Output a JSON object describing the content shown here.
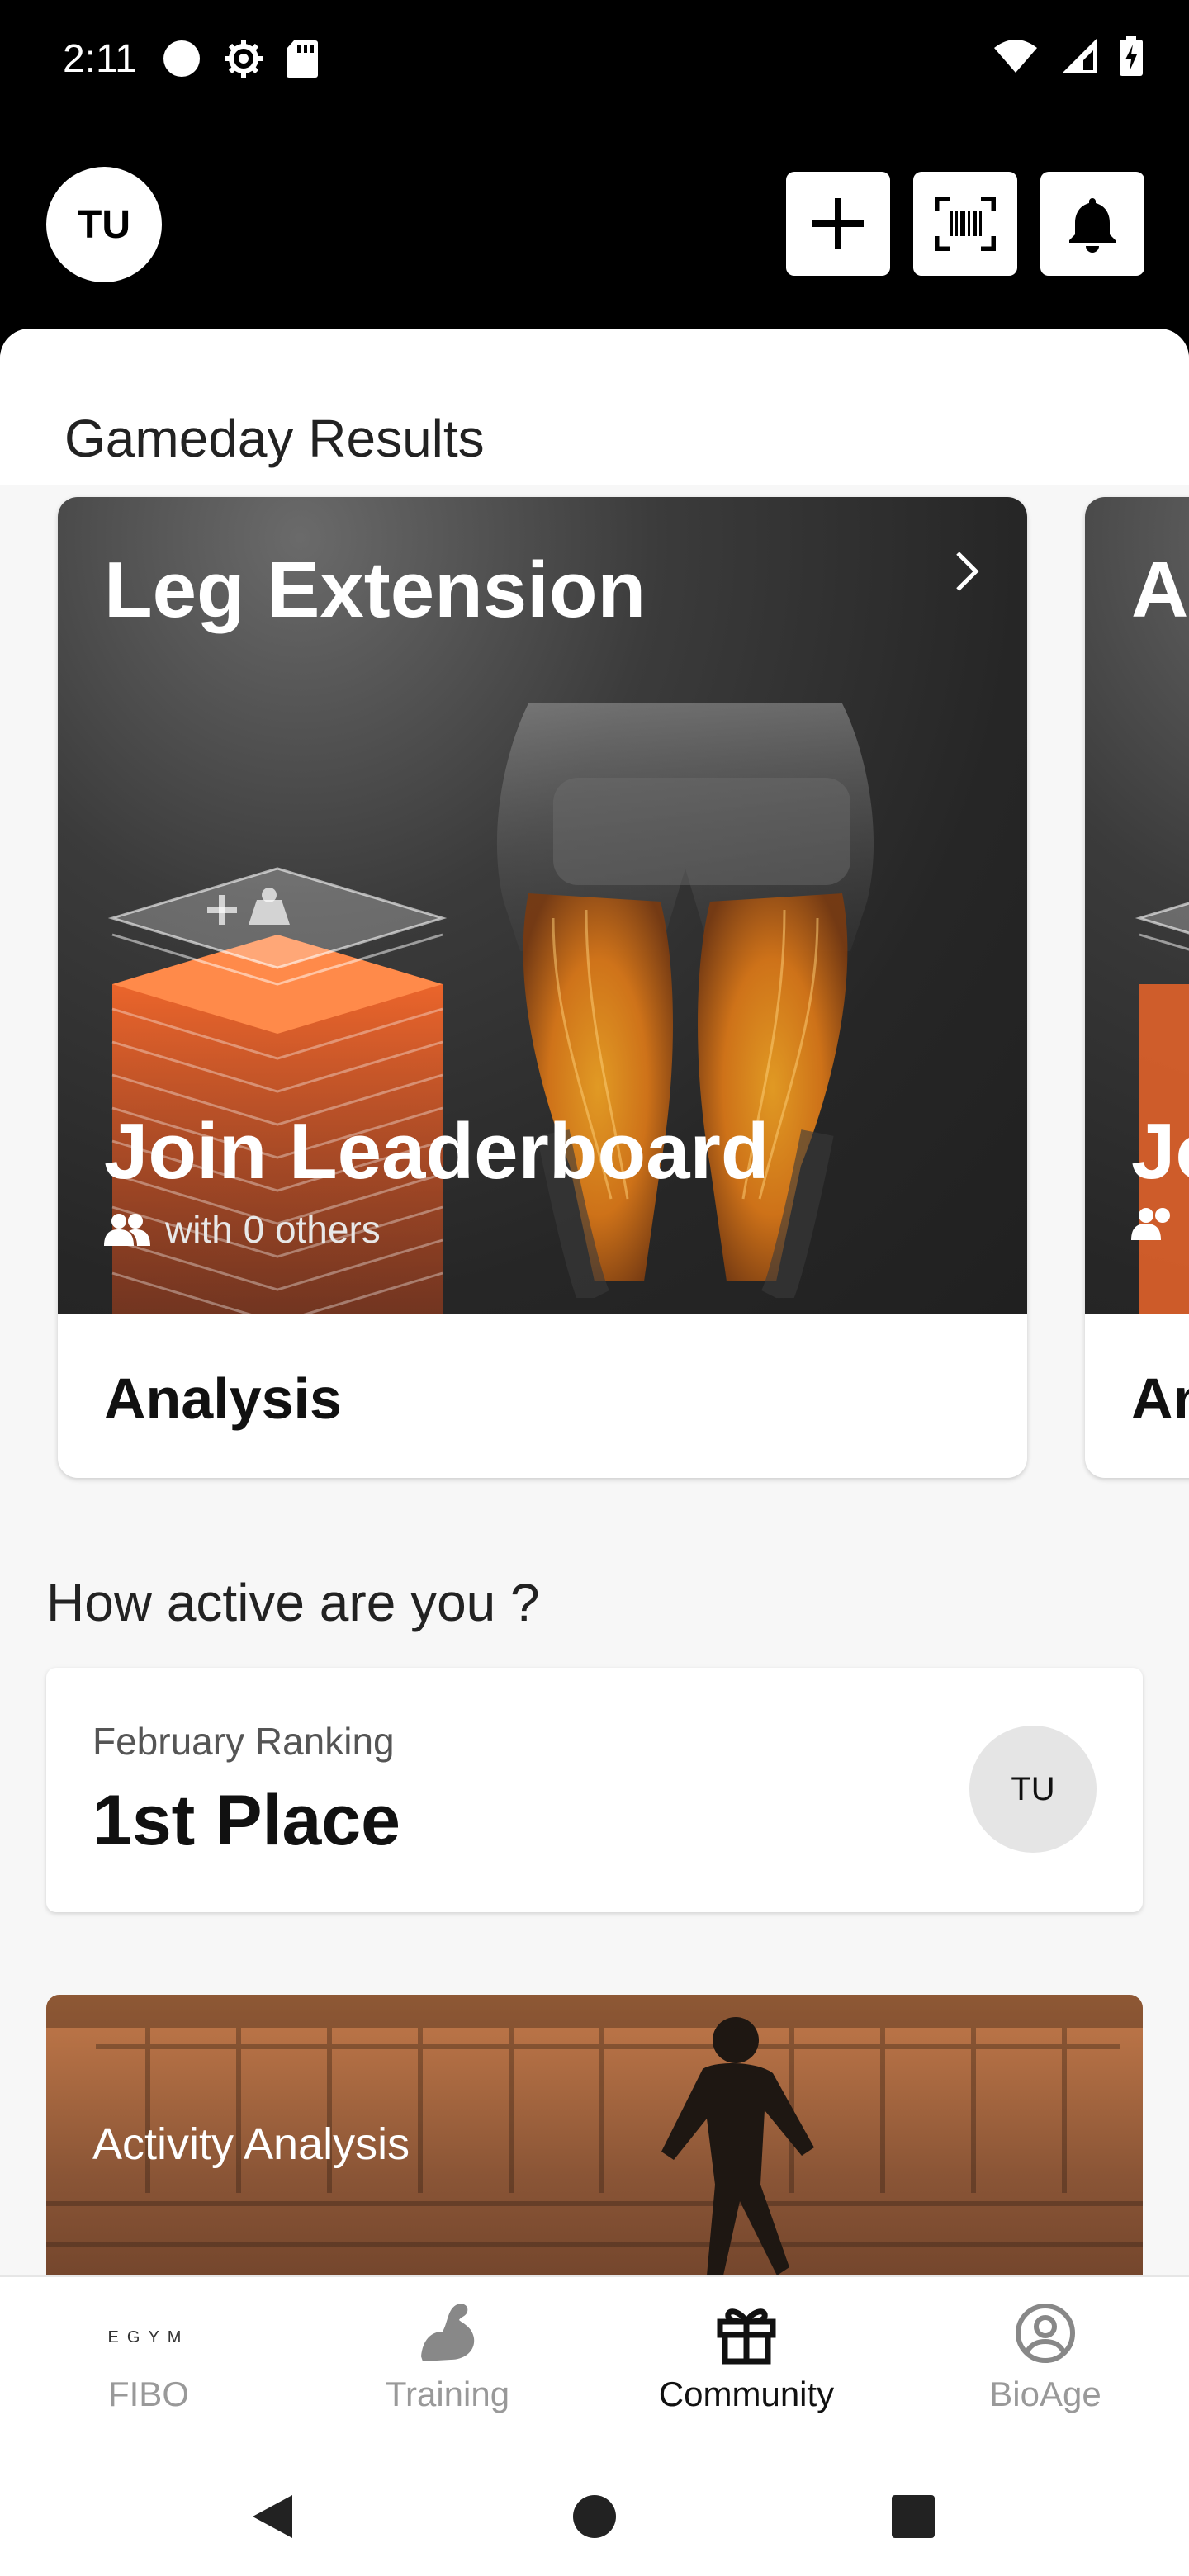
{
  "status_bar": {
    "time": "2:11"
  },
  "top_bar": {
    "avatar_initials": "TU"
  },
  "gameday": {
    "section_title": "Gameday Results",
    "cards": [
      {
        "title": "Leg Extension",
        "cta_title": "Join Leaderboard",
        "cta_subtitle": "with 0 others",
        "footer_label": "Analysis"
      },
      {
        "title": "A",
        "cta_title": "Jo",
        "footer_label": "An"
      }
    ]
  },
  "activity": {
    "section_title": "How active are you ?",
    "ranking_label": "February Ranking",
    "ranking_value": "1st Place",
    "avatar_initials": "TU",
    "analysis_card_title": "Activity Analysis"
  },
  "bottom_nav": {
    "items": [
      {
        "label": "FIBO",
        "logo_text": "EGYM"
      },
      {
        "label": "Training"
      },
      {
        "label": "Community"
      },
      {
        "label": "BioAge"
      }
    ],
    "active_index": 2
  },
  "colors": {
    "accent_orange": "#e0622a",
    "background_dark": "#000000",
    "sheet_background": "#f7f7f7"
  }
}
